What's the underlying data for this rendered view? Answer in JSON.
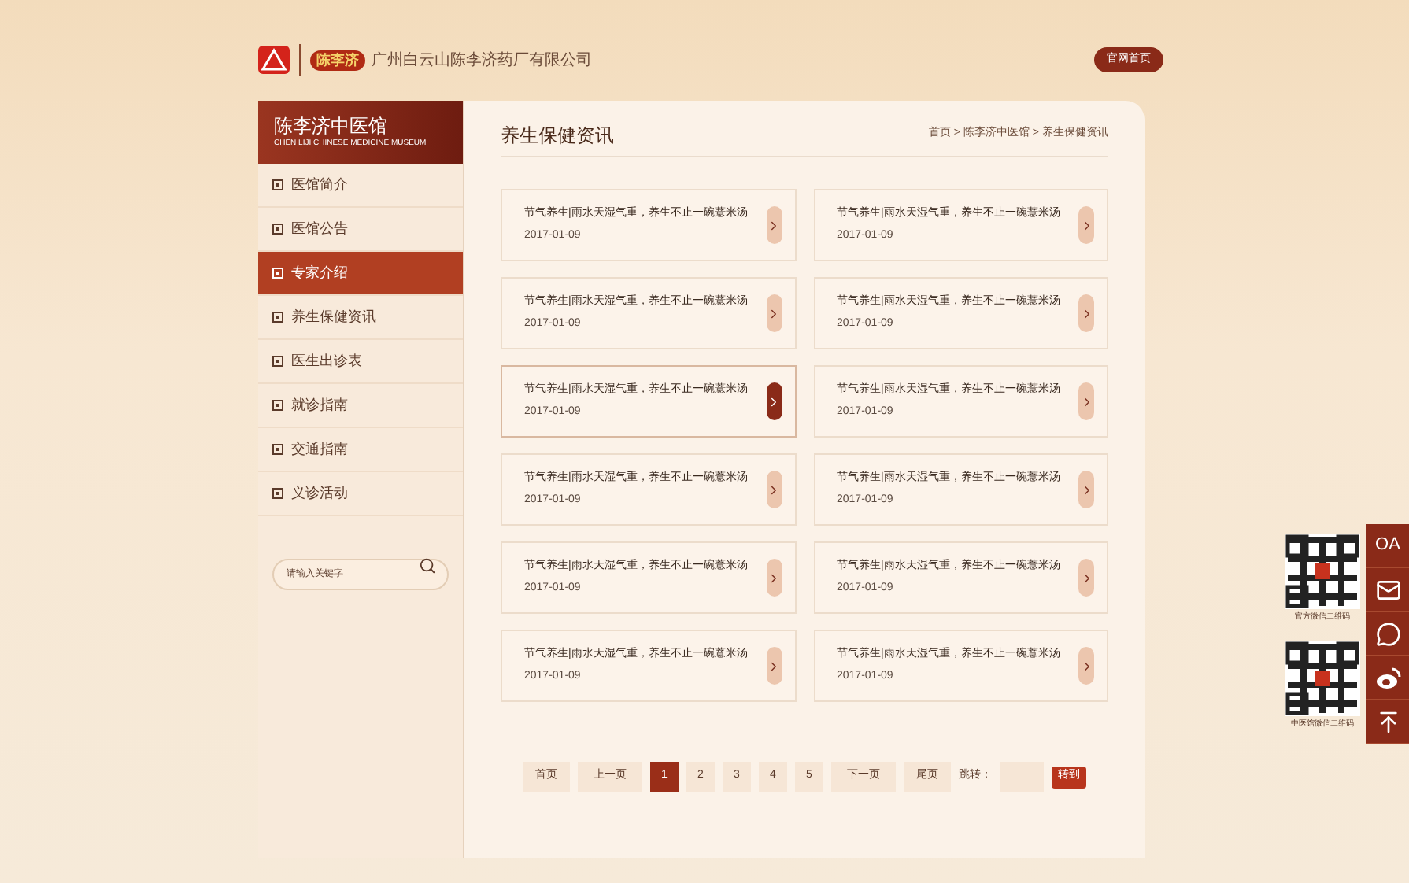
{
  "header": {
    "logo_text": "陈李济",
    "company": "广州白云山陈李济药厂有限公司",
    "home_button": "官网首页"
  },
  "sidebar": {
    "title": "陈李济中医馆",
    "subtitle": "CHEN LIJI CHINESE MEDICINE MUSEUM",
    "items": [
      {
        "label": "医馆简介",
        "selected": false
      },
      {
        "label": "医馆公告",
        "selected": false
      },
      {
        "label": "专家介绍",
        "selected": true
      },
      {
        "label": "养生保健资讯",
        "selected": false
      },
      {
        "label": "医生出诊表",
        "selected": false
      },
      {
        "label": "就诊指南",
        "selected": false
      },
      {
        "label": "交通指南",
        "selected": false
      },
      {
        "label": "义诊活动",
        "selected": false
      }
    ],
    "search": {
      "placeholder": "请输入关键字"
    }
  },
  "content": {
    "title": "养生保健资讯",
    "breadcrumb": [
      "首页",
      "陈李济中医馆",
      "养生保健资讯"
    ],
    "breadcrumb_separator": ">",
    "articles": [
      {
        "title": "节气养生|雨水天湿气重，养生不止一碗薏米汤",
        "date": "2017-01-09",
        "selected": false
      },
      {
        "title": "节气养生|雨水天湿气重，养生不止一碗薏米汤",
        "date": "2017-01-09",
        "selected": false
      },
      {
        "title": "节气养生|雨水天湿气重，养生不止一碗薏米汤",
        "date": "2017-01-09",
        "selected": false
      },
      {
        "title": "节气养生|雨水天湿气重，养生不止一碗薏米汤",
        "date": "2017-01-09",
        "selected": false
      },
      {
        "title": "节气养生|雨水天湿气重，养生不止一碗薏米汤",
        "date": "2017-01-09",
        "selected": true
      },
      {
        "title": "节气养生|雨水天湿气重，养生不止一碗薏米汤",
        "date": "2017-01-09",
        "selected": false
      },
      {
        "title": "节气养生|雨水天湿气重，养生不止一碗薏米汤",
        "date": "2017-01-09",
        "selected": false
      },
      {
        "title": "节气养生|雨水天湿气重，养生不止一碗薏米汤",
        "date": "2017-01-09",
        "selected": false
      },
      {
        "title": "节气养生|雨水天湿气重，养生不止一碗薏米汤",
        "date": "2017-01-09",
        "selected": false
      },
      {
        "title": "节气养生|雨水天湿气重，养生不止一碗薏米汤",
        "date": "2017-01-09",
        "selected": false
      },
      {
        "title": "节气养生|雨水天湿气重，养生不止一碗薏米汤",
        "date": "2017-01-09",
        "selected": false
      },
      {
        "title": "节气养生|雨水天湿气重，养生不止一碗薏米汤",
        "date": "2017-01-09",
        "selected": false
      }
    ],
    "pagination": {
      "first": "首页",
      "prev": "上一页",
      "pages": [
        {
          "label": "1",
          "selected": true
        },
        {
          "label": "2",
          "selected": false
        },
        {
          "label": "3",
          "selected": false
        },
        {
          "label": "4",
          "selected": false
        },
        {
          "label": "5",
          "selected": false
        }
      ],
      "next": "下一页",
      "last": "尾页",
      "jump_label": "跳转：",
      "go": "转到"
    }
  },
  "float_bar": {
    "qr_captions": [
      "官方微信二维码",
      "中医馆微信二维码"
    ],
    "buttons": [
      {
        "kind": "text",
        "label": "OA"
      },
      {
        "kind": "mail"
      },
      {
        "kind": "wechat"
      },
      {
        "kind": "weibo"
      },
      {
        "kind": "top"
      }
    ]
  }
}
